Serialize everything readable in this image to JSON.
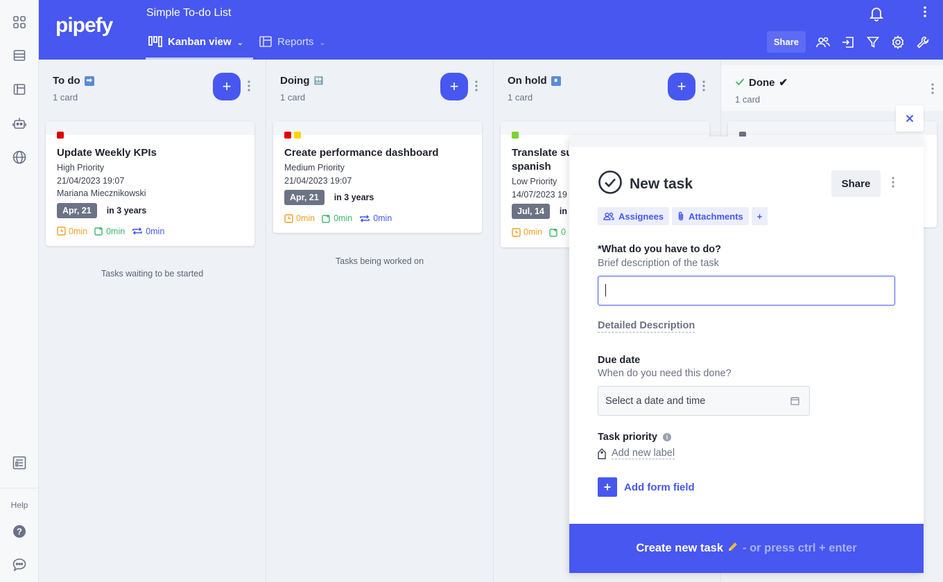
{
  "app": {
    "logo": "pipefy",
    "pipe_title": "Simple To-do List"
  },
  "tabs": [
    {
      "label": "Kanban view",
      "active": true
    },
    {
      "label": "Reports",
      "active": false
    }
  ],
  "toolbar": {
    "share_label": "Share"
  },
  "sidebar": {
    "help_label": "Help"
  },
  "columns": [
    {
      "title": "To do",
      "emoji": "➡",
      "count": "1 card",
      "description": "Tasks waiting to be started",
      "card": {
        "tags": [
          "#e00000"
        ],
        "title": "Update Weekly KPIs",
        "lines": [
          "High Priority",
          "21/04/2023 19:07",
          "Mariana Miecznikowski"
        ],
        "due_badge": "Apr, 21",
        "due_relative": "in 3 years",
        "timers": [
          "0min",
          "0min",
          "0min"
        ]
      }
    },
    {
      "title": "Doing",
      "emoji": "🔛",
      "count": "1 card",
      "description": "Tasks being worked on",
      "card": {
        "tags": [
          "#e00000",
          "#ffd500"
        ],
        "title": "Create performance dashboard",
        "lines": [
          "Medium Priority",
          "21/04/2023 19:07"
        ],
        "due_badge": "Apr, 21",
        "due_relative": "in 3 years",
        "timers": [
          "0min",
          "0min",
          "0min"
        ]
      }
    },
    {
      "title": "On hold",
      "emoji": "⏸",
      "count": "1 card",
      "description": "",
      "card": {
        "tags": [
          "#7bd32c"
        ],
        "title_line1": "Translate su",
        "title_line2": "spanish",
        "lines": [
          "Low Priority",
          "14/07/2023 19"
        ],
        "due_badge": "Jul, 14",
        "due_relative": "in",
        "timers": [
          "0min",
          "0"
        ]
      }
    },
    {
      "title": "Done",
      "emoji": "✔",
      "count": "1 card"
    }
  ],
  "modal": {
    "title": "New task",
    "share_label": "Share",
    "chips": [
      "Assignees",
      "Attachments",
      "+"
    ],
    "field1_label": "*What do you have to do?",
    "field1_help": "Brief description of the task",
    "detailed_description": "Detailed Description",
    "due_label": "Due date",
    "due_help": "When do you need this done?",
    "due_placeholder": "Select a date and time",
    "priority_label": "Task priority",
    "add_label": "Add new label",
    "add_field": "Add form field",
    "submit_label": "Create new task",
    "submit_hint": "- or press ctrl + enter"
  },
  "colors": {
    "brand": "#4757f0",
    "badge": "#6c7385"
  }
}
